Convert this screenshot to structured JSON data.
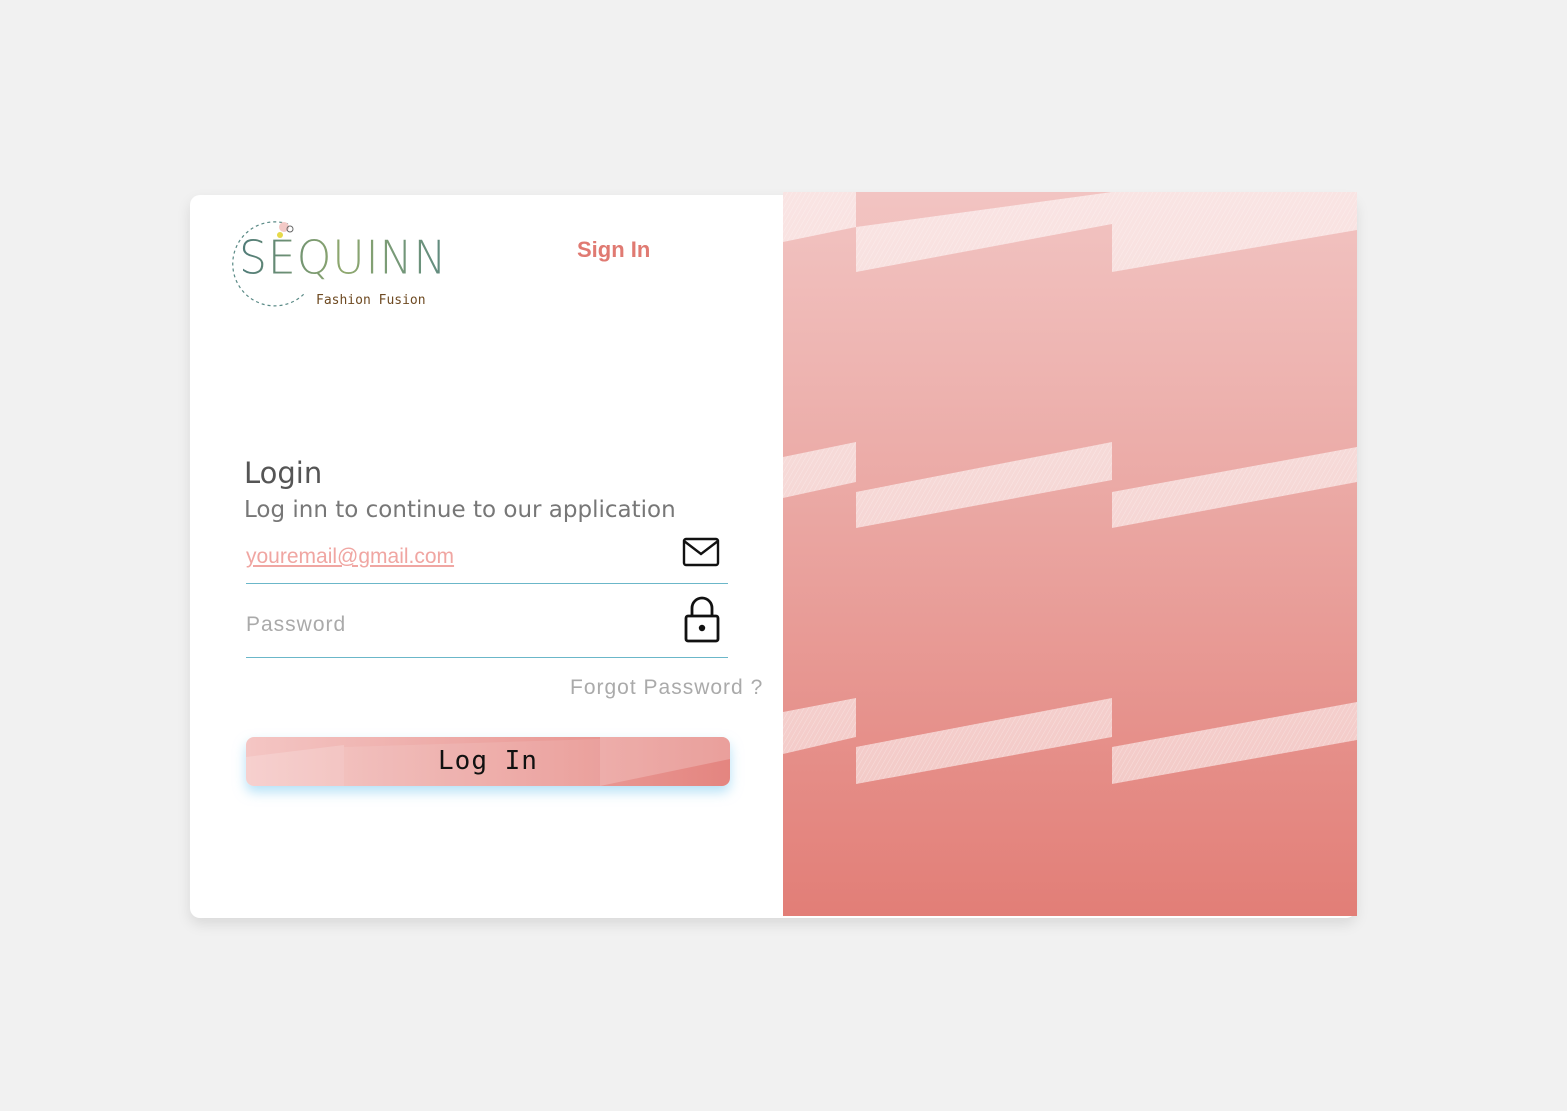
{
  "brand": {
    "name": "SEQUINN",
    "tagline": "Fashion Fusion"
  },
  "header": {
    "sign_in_label": "Sign In"
  },
  "form": {
    "title": "Login",
    "subtitle": "Log inn to continue to our application",
    "email": {
      "value": "",
      "placeholder": "youremail@gmail.com",
      "icon": "mail-icon"
    },
    "password": {
      "value": "",
      "placeholder": "Password",
      "icon": "lock-icon"
    },
    "forgot_label": "Forgot Password ?",
    "login_label": "Log In"
  },
  "colors": {
    "accent": "#e07a72",
    "gradient_top": "#f2c4c2",
    "gradient_bottom": "#e27e77",
    "field_underline": "#6bb7c9"
  }
}
